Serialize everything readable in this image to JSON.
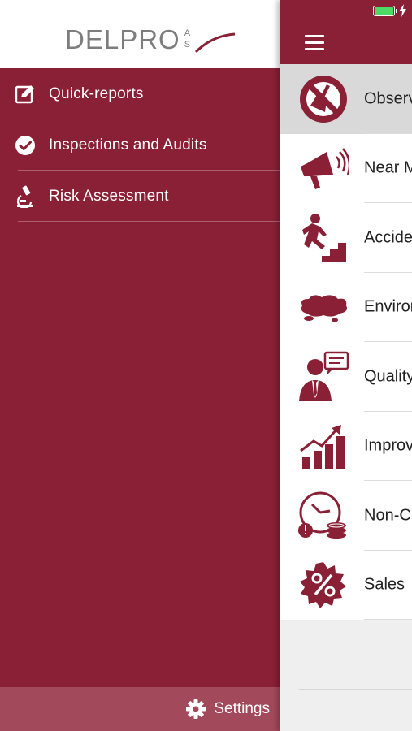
{
  "drawer": {
    "logo": {
      "main": "DELPRO",
      "sub_line1": "A",
      "sub_line2": "S"
    },
    "items": [
      {
        "label": "Quick-reports",
        "icon": "edit-icon"
      },
      {
        "label": "Inspections and Audits",
        "icon": "checkmark-circle-icon"
      },
      {
        "label": "Risk Assessment",
        "icon": "microscope-icon"
      }
    ],
    "settings": {
      "label": "Settings",
      "icon": "gear-icon"
    }
  },
  "panel": {
    "status": {
      "battery_icon": "battery-icon",
      "charging_icon": "lightning-icon"
    },
    "navbar": {
      "menu_icon": "hamburger-icon"
    },
    "categories": [
      {
        "label": "Observ",
        "icon": "no-broom-icon",
        "selected": true
      },
      {
        "label": "Near M",
        "icon": "megaphone-icon"
      },
      {
        "label": "Accide",
        "icon": "fall-on-stairs-icon"
      },
      {
        "label": "Enviror",
        "icon": "spill-icon"
      },
      {
        "label": "Quality",
        "icon": "businessman-speech-icon"
      },
      {
        "label": "Improv",
        "icon": "growth-chart-icon"
      },
      {
        "label": "Non-C",
        "icon": "clock-coins-icon"
      },
      {
        "label": "Sales",
        "icon": "percent-badge-icon"
      }
    ]
  },
  "colors": {
    "brand": "#8a2035",
    "settings_bar": "#a24a5b",
    "selected_row": "#d9d9d9",
    "battery": "#4cd964"
  }
}
